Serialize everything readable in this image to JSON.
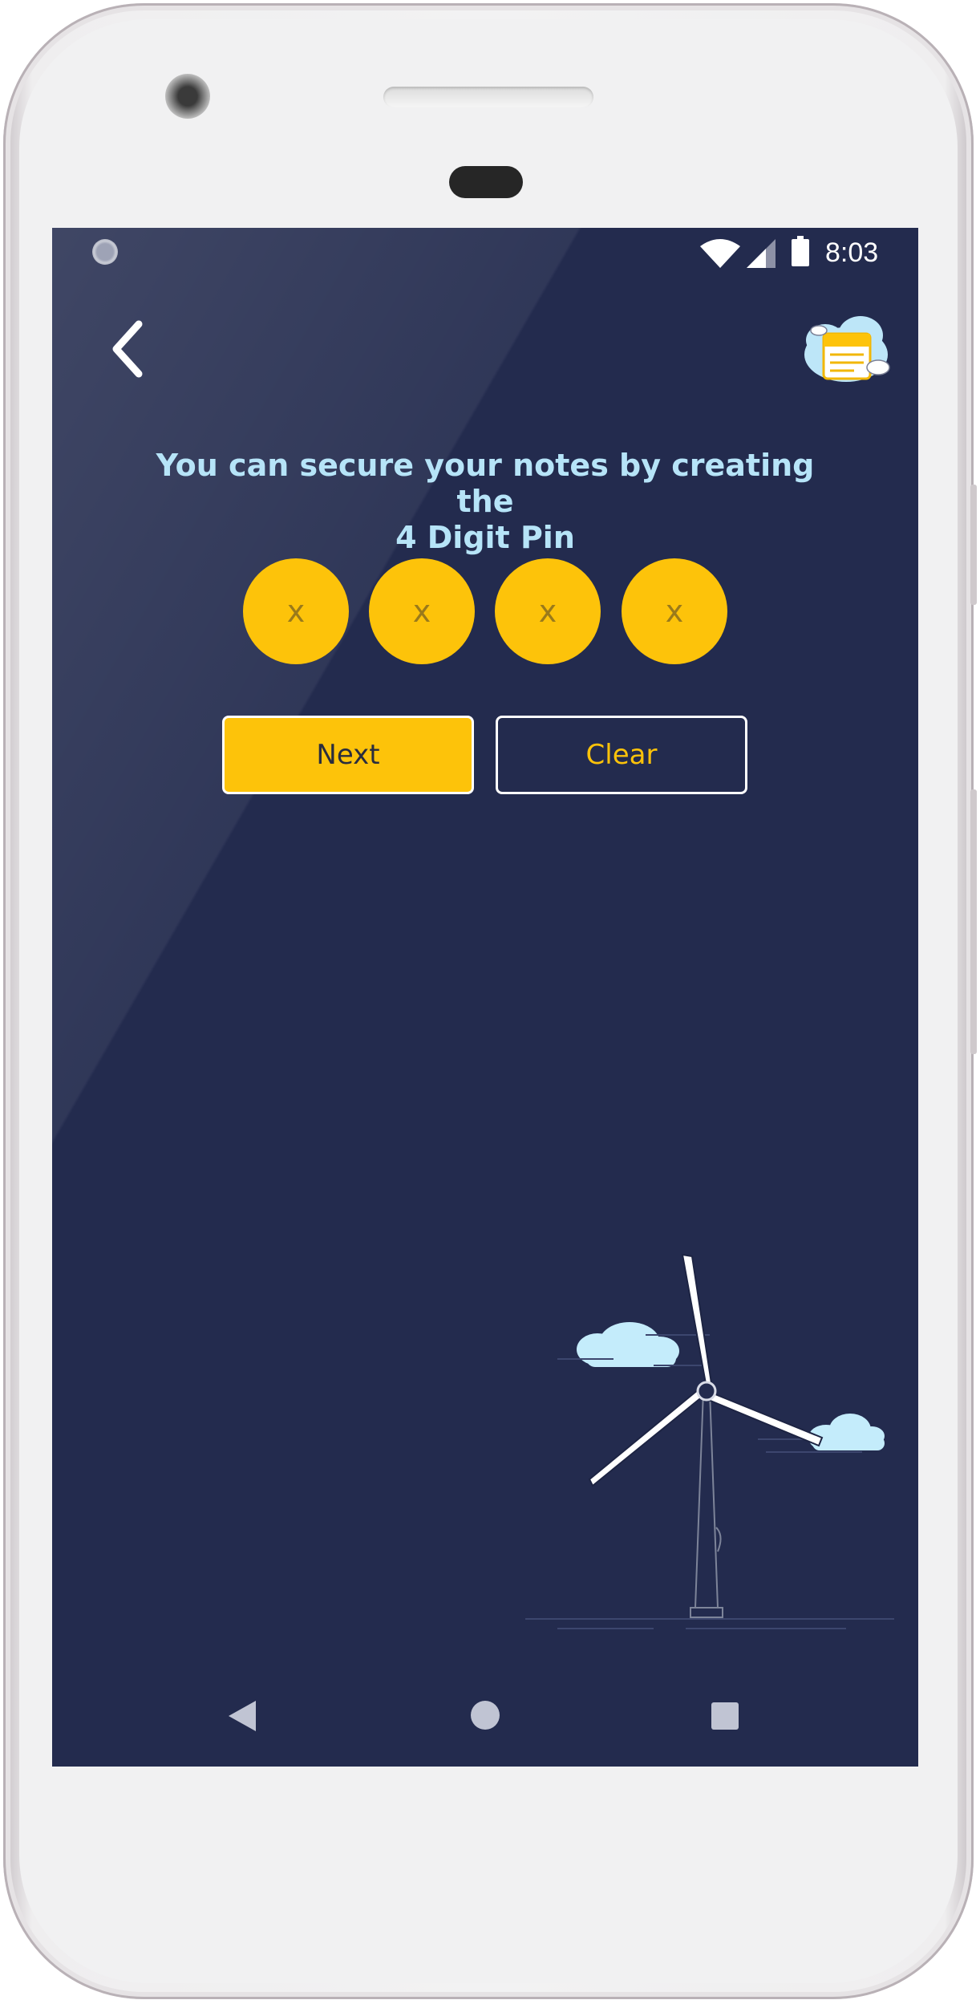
{
  "status_bar": {
    "time": "8:03",
    "icons": [
      "notification-dot-icon",
      "wifi-icon",
      "signal-icon",
      "battery-icon"
    ]
  },
  "app_bar": {
    "back_icon": "chevron-left-icon",
    "logo_icon": "notes-calendar-cloud-icon"
  },
  "instruction": {
    "line1": "You can secure your notes by creating the",
    "line2": "4 Digit Pin"
  },
  "pin": {
    "digits": [
      "x",
      "x",
      "x",
      "x"
    ]
  },
  "buttons": {
    "next_label": "Next",
    "clear_label": "Clear"
  },
  "nav_bar": {
    "icons": [
      "nav-back-icon",
      "nav-home-icon",
      "nav-recents-icon"
    ]
  },
  "colors": {
    "background": "#232b4e",
    "accent": "#fdc30a",
    "instruction_text": "#b6e4f8",
    "pin_text": "#9a7a1b"
  }
}
